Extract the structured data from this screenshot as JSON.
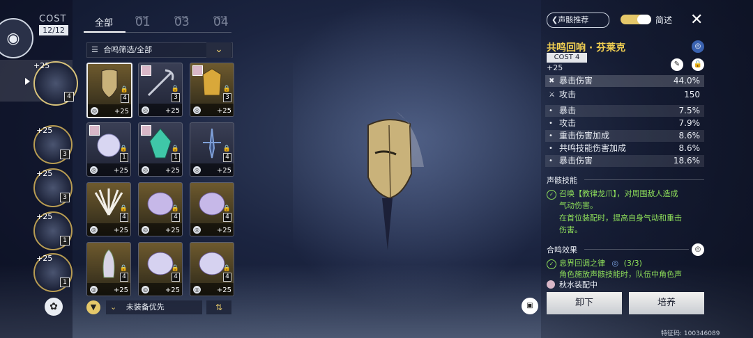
{
  "cost": {
    "label": "COST",
    "value": "12/12"
  },
  "equipped": [
    {
      "level": "+25",
      "cost": "4",
      "selected": true
    },
    {
      "level": "+25",
      "cost": "3"
    },
    {
      "level": "+25",
      "cost": "3"
    },
    {
      "level": "+25",
      "cost": "1"
    },
    {
      "level": "+25",
      "cost": "1"
    }
  ],
  "tabs": {
    "all": "全部",
    "cost_small": "COST",
    "t1": "01",
    "t3": "03",
    "t4": "04"
  },
  "filter": {
    "label": "合鸣筛选/全部"
  },
  "grid": [
    {
      "cost": "4",
      "plus": "+25"
    },
    {
      "cost": "3",
      "plus": "+25"
    },
    {
      "cost": "3",
      "plus": "+25"
    },
    {
      "cost": "1",
      "plus": "+25"
    },
    {
      "cost": "1",
      "plus": "+25"
    },
    {
      "cost": "4",
      "plus": "+25"
    },
    {
      "cost": "4",
      "plus": "+25"
    },
    {
      "cost": "4",
      "plus": "+25"
    },
    {
      "cost": "4",
      "plus": "+25"
    },
    {
      "cost": "4",
      "plus": "+25"
    },
    {
      "cost": "4",
      "plus": "+25"
    },
    {
      "cost": "4",
      "plus": "+25"
    }
  ],
  "sort": {
    "label": "未装备优先"
  },
  "right": {
    "back_label": "声骸推荐",
    "toggle_label": "简述",
    "name": "共鸣回响 · 芬莱克",
    "cost_tag": "COST 4",
    "level": "+25",
    "main_stats": [
      {
        "name": "暴击伤害",
        "value": "44.0%"
      },
      {
        "name": "攻击",
        "value": "150"
      }
    ],
    "sub_stats": [
      {
        "name": "暴击",
        "value": "7.5%"
      },
      {
        "name": "攻击",
        "value": "7.9%"
      },
      {
        "name": "重击伤害加成",
        "value": "8.6%"
      },
      {
        "name": "共鸣技能伤害加成",
        "value": "8.6%"
      },
      {
        "name": "暴击伤害",
        "value": "18.6%"
      }
    ],
    "skill_title": "声骸技能",
    "skill_lines": [
      "召唤【教律龙爪】，对周围敌人造成",
      "气动伤害。",
      "在首位装配时，提高自身气动和重击",
      "伤害。"
    ],
    "sonata_title": "合鸣效果",
    "sonata_name": "息界回调之律",
    "sonata_count": "(3/3)",
    "sonata_desc": "角色施放声骸技能时，队伍中角色声",
    "equipped_by": "秋水装配中",
    "unequip_label": "卸下",
    "upgrade_label": "培养",
    "uid": "特征码: 100346089"
  }
}
